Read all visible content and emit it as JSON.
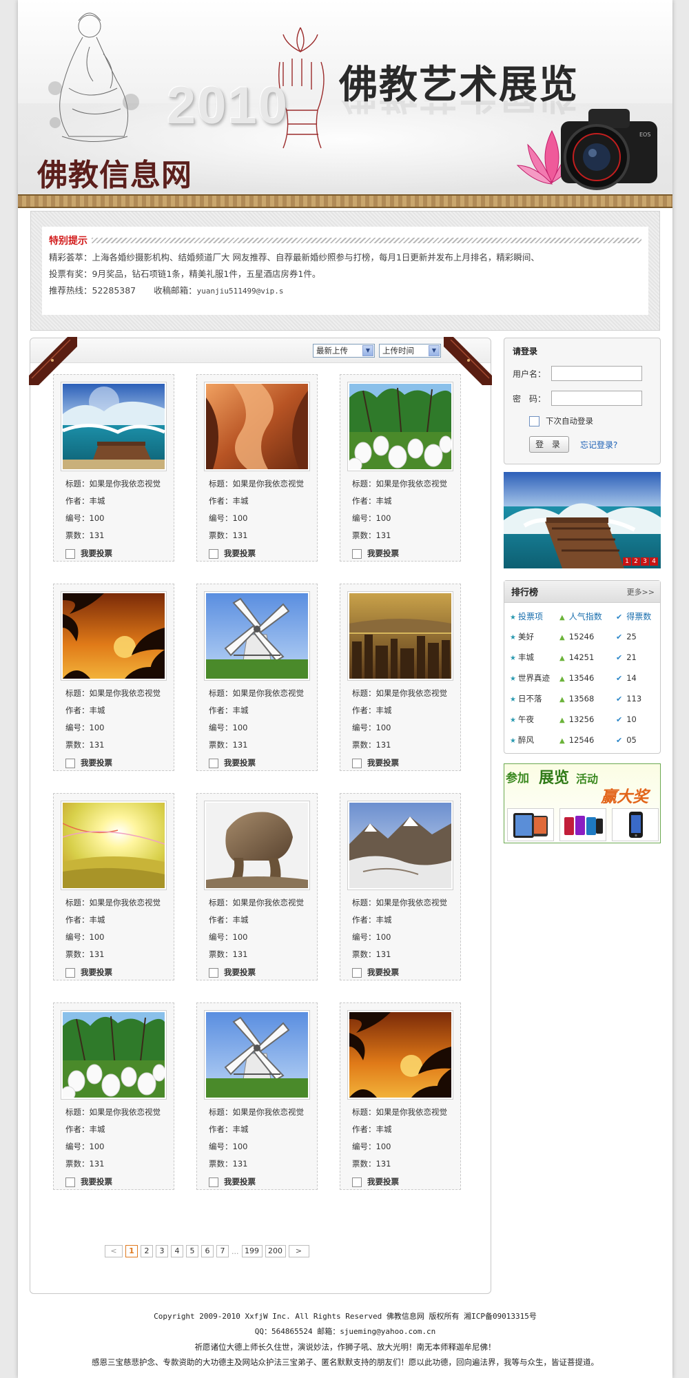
{
  "banner": {
    "year": "2010",
    "main_title": "佛教艺术展览",
    "site_name": "佛教信息网"
  },
  "notice": {
    "title": "特别提示",
    "line1": "精彩荟萃：上海各婚纱摄影机构、结婚频道厂大 网友推荐、自荐最新婚纱照参与打榜，每月1日更新并发布上月排名，精彩瞬间、",
    "line2": "投票有奖：9月奖品，钻石项链1条，精美礼服1件，五星酒店房券1件。",
    "hotline_label": "推荐热线：",
    "hotline": "52285387",
    "email_label": "收稿邮箱：",
    "email": "yuanjiu511499@vip.s"
  },
  "sort": {
    "option_a": "最新上传",
    "option_b": "上传时间"
  },
  "card_labels": {
    "title": "标题：",
    "author": "作者：",
    "number": "编号：",
    "votes": "票数：",
    "vote_action": "我要投票"
  },
  "cards": [
    {
      "photo": "sea-pier",
      "title": "如果是你我依恋视觉",
      "author": "丰城",
      "number": "100",
      "votes": "131"
    },
    {
      "photo": "canyon",
      "title": "如果是你我依恋视觉",
      "author": "丰城",
      "number": "100",
      "votes": "131"
    },
    {
      "photo": "tulips",
      "title": "如果是你我依恋视觉",
      "author": "丰城",
      "number": "100",
      "votes": "131"
    },
    {
      "photo": "palm-sunset",
      "title": "如果是你我依恋视觉",
      "author": "丰城",
      "number": "100",
      "votes": "131"
    },
    {
      "photo": "windmill",
      "title": "如果是你我依恋视觉",
      "author": "丰城",
      "number": "100",
      "votes": "131"
    },
    {
      "photo": "city-dusk",
      "title": "如果是你我依恋视觉",
      "author": "丰城",
      "number": "100",
      "votes": "131"
    },
    {
      "photo": "sun-field",
      "title": "如果是你我依恋视觉",
      "author": "丰城",
      "number": "100",
      "votes": "131"
    },
    {
      "photo": "rock-arch",
      "title": "如果是你我依恋视觉",
      "author": "丰城",
      "number": "100",
      "votes": "131"
    },
    {
      "photo": "mountains",
      "title": "如果是你我依恋视觉",
      "author": "丰城",
      "number": "100",
      "votes": "131"
    },
    {
      "photo": "tulips",
      "title": "如果是你我依恋视觉",
      "author": "丰城",
      "number": "100",
      "votes": "131"
    },
    {
      "photo": "windmill",
      "title": "如果是你我依恋视觉",
      "author": "丰城",
      "number": "100",
      "votes": "131"
    },
    {
      "photo": "palm-sunset",
      "title": "如果是你我依恋视觉",
      "author": "丰城",
      "number": "100",
      "votes": "131"
    }
  ],
  "pager": {
    "prev": "<",
    "pages": [
      "1",
      "2",
      "3",
      "4",
      "5",
      "6",
      "7"
    ],
    "current": "1",
    "ellipsis": "...",
    "tail": [
      "199",
      "200"
    ],
    "next": ">"
  },
  "login": {
    "title": "请登录",
    "username_label": "用户名：",
    "password_label": "密　码：",
    "remember": "下次自动登录",
    "submit": "登 录",
    "forgot": "忘记登录?"
  },
  "slideshow": {
    "numbers": [
      "1",
      "2",
      "3",
      "4"
    ]
  },
  "ranking": {
    "title": "排行榜",
    "more": "更多>>",
    "headers": [
      "投票项",
      "人气指数",
      "得票数"
    ],
    "rows": [
      {
        "name": "美好",
        "popularity": "15246",
        "votes": "25"
      },
      {
        "name": "丰城",
        "popularity": "14251",
        "votes": "21"
      },
      {
        "name": "世界真迹",
        "popularity": "13546",
        "votes": "14"
      },
      {
        "name": "日不落",
        "popularity": "13568",
        "votes": "113"
      },
      {
        "name": "午夜",
        "popularity": "13256",
        "votes": "10"
      },
      {
        "name": "醉风",
        "popularity": "12546",
        "votes": "05"
      }
    ]
  },
  "promo": {
    "w1": "参加",
    "w2": "展览",
    "w3": "活动",
    "w4": "赢大奖"
  },
  "footer": {
    "line1": "Copyright 2009-2010 XxfjW Inc. All Rights Reserved 佛教信息网 版权所有 湘ICP备09013315号",
    "line2": "QQ：564865524 邮箱：sjueming@yahoo.com.cn",
    "line3": "祈愿诸位大德上师长久住世，演说妙法，作狮子吼、放大光明！南无本师释迦牟尼佛！",
    "line4": "感恩三宝慈悲护念、专款资助的大功德主及网站众护法三宝弟子、匿名默默支持的朋友们！愿以此功德，回向遍法界，我等与众生，皆证菩提道。"
  },
  "colors": {
    "notice_title": "#d21a1a",
    "site_name": "#5b1f1c",
    "link": "#1a5fb4",
    "pager_active": "#e07a1f"
  }
}
